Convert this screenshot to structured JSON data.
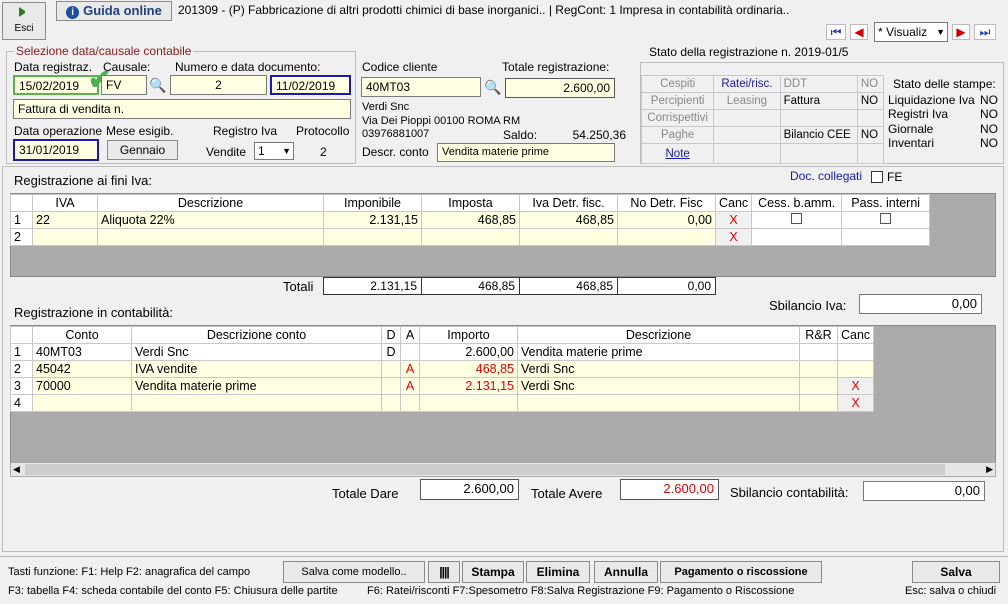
{
  "top": {
    "esci": "Esci",
    "guida": "Guida online",
    "title": "201309 - (P) Fabbricazione di altri prodotti chimici di base inorganici.. | RegCont: 1 Impresa  in contabilità ordinaria..",
    "view": "* Visualiz"
  },
  "sel": {
    "legend": "Selezione data/causale contabile",
    "data_reg_label": "Data registraz.",
    "data_reg": "15/02/2019",
    "causale_label": "Causale:",
    "causale": "FV",
    "numdoc_label": "Numero e data documento:",
    "numdoc": "2",
    "datadoc": "11/02/2019",
    "descr": "Fattura di vendita n.",
    "data_op_label": "Data operazione",
    "data_op": "31/01/2019",
    "mese_label": "Mese esigib.",
    "mese": "Gennaio",
    "reg_iva_label": "Registro Iva",
    "reg_iva_type": "Vendite",
    "reg_iva_num": "1",
    "prot_label": "Protocollo",
    "prot": "2"
  },
  "cliente": {
    "codice_label": "Codice cliente",
    "codice": "40MT03",
    "totale_label": "Totale registrazione:",
    "totale": "2.600,00",
    "nome": "Verdi Snc",
    "indirizzo": "Via Dei Pioppi 00100 ROMA RM",
    "piva": "03976881007",
    "saldo_label": "Saldo:",
    "saldo": "54.250,36",
    "descr_conto_label": "Descr. conto",
    "descr_conto": "Vendita materie prime"
  },
  "stato": {
    "title": "Stato della registrazione n. 2019-01/5",
    "cells": [
      [
        "Cespiti",
        "Ratei/risc.",
        "DDT",
        "NO"
      ],
      [
        "Percipienti",
        "Leasing",
        "Fattura",
        "NO"
      ],
      [
        "Corrispettivi",
        "",
        "",
        ""
      ],
      [
        "Paghe",
        "",
        "Bilancio CEE",
        "NO"
      ],
      [
        "Note",
        "",
        "",
        ""
      ]
    ],
    "stampe_title": "Stato delle stampe:",
    "stampe": [
      [
        "Liquidazione Iva",
        "NO"
      ],
      [
        "Registri Iva",
        "NO"
      ],
      [
        "Giornale",
        "NO"
      ],
      [
        "Inventari",
        "NO"
      ]
    ]
  },
  "iva": {
    "title": "Registrazione ai fini Iva:",
    "doc_collegati": "Doc. collegati",
    "fe": "FE",
    "headers": [
      "IVA",
      "Descrizione",
      "Imponibile",
      "Imposta",
      "Iva Detr. fisc.",
      "No Detr. Fisc",
      "Canc",
      "Cess. b.amm.",
      "Pass. interni"
    ],
    "rows": [
      {
        "n": "1",
        "iva": "22",
        "descr": "Aliquota 22%",
        "imp": "2.131,15",
        "imposta": "468,85",
        "detr": "468,85",
        "nodetr": "0,00"
      },
      {
        "n": "2",
        "iva": "",
        "descr": "",
        "imp": "",
        "imposta": "",
        "detr": "",
        "nodetr": ""
      }
    ],
    "totali_label": "Totali",
    "totali": [
      "2.131,15",
      "468,85",
      "468,85",
      "0,00"
    ],
    "sbil_label": "Sbilancio Iva:",
    "sbil": "0,00",
    "x": "X"
  },
  "cont": {
    "title": "Registrazione in contabilità:",
    "headers": [
      "Conto",
      "Descrizione conto",
      "D",
      "A",
      "Importo",
      "Descrizione",
      "R&R",
      "Canc"
    ],
    "rows": [
      {
        "n": "1",
        "conto": "40MT03",
        "descr": "Verdi Snc",
        "d": "D",
        "a": "",
        "imp": "2.600,00",
        "descr2": "Vendita materie prime"
      },
      {
        "n": "2",
        "conto": "45042",
        "descr": "IVA vendite",
        "d": "",
        "a": "A",
        "imp": "468,85",
        "descr2": "Verdi Snc"
      },
      {
        "n": "3",
        "conto": "70000",
        "descr": "Vendita materie prime",
        "d": "",
        "a": "A",
        "imp": "2.131,15",
        "descr2": "Verdi Snc"
      },
      {
        "n": "4",
        "conto": "",
        "descr": "",
        "d": "",
        "a": "",
        "imp": "",
        "descr2": ""
      }
    ],
    "dare_label": "Totale Dare",
    "dare": "2.600,00",
    "avere_label": "Totale Avere",
    "avere": "2.600,00",
    "sbil_label": "Sbilancio contabilità:",
    "sbil": "0,00"
  },
  "footer": {
    "tasti1": "Tasti funzione:  F1: Help   F2: anagrafica del campo",
    "tasti2": "F3: tabella    F4: scheda contabile del conto   F5: Chiusura delle partite",
    "tasti3": "F6: Ratei/risconti    F7:Spesometro    F8:Salva Registrazione      F9: Pagamento o Riscossione",
    "tasti4": "Esc: salva o chiudi",
    "salva_modello": "Salva come modello..",
    "stampa": "Stampa",
    "elimina": "Elimina",
    "annulla": "Annulla",
    "pagamento": "Pagamento o riscossione",
    "salva": "Salva"
  }
}
